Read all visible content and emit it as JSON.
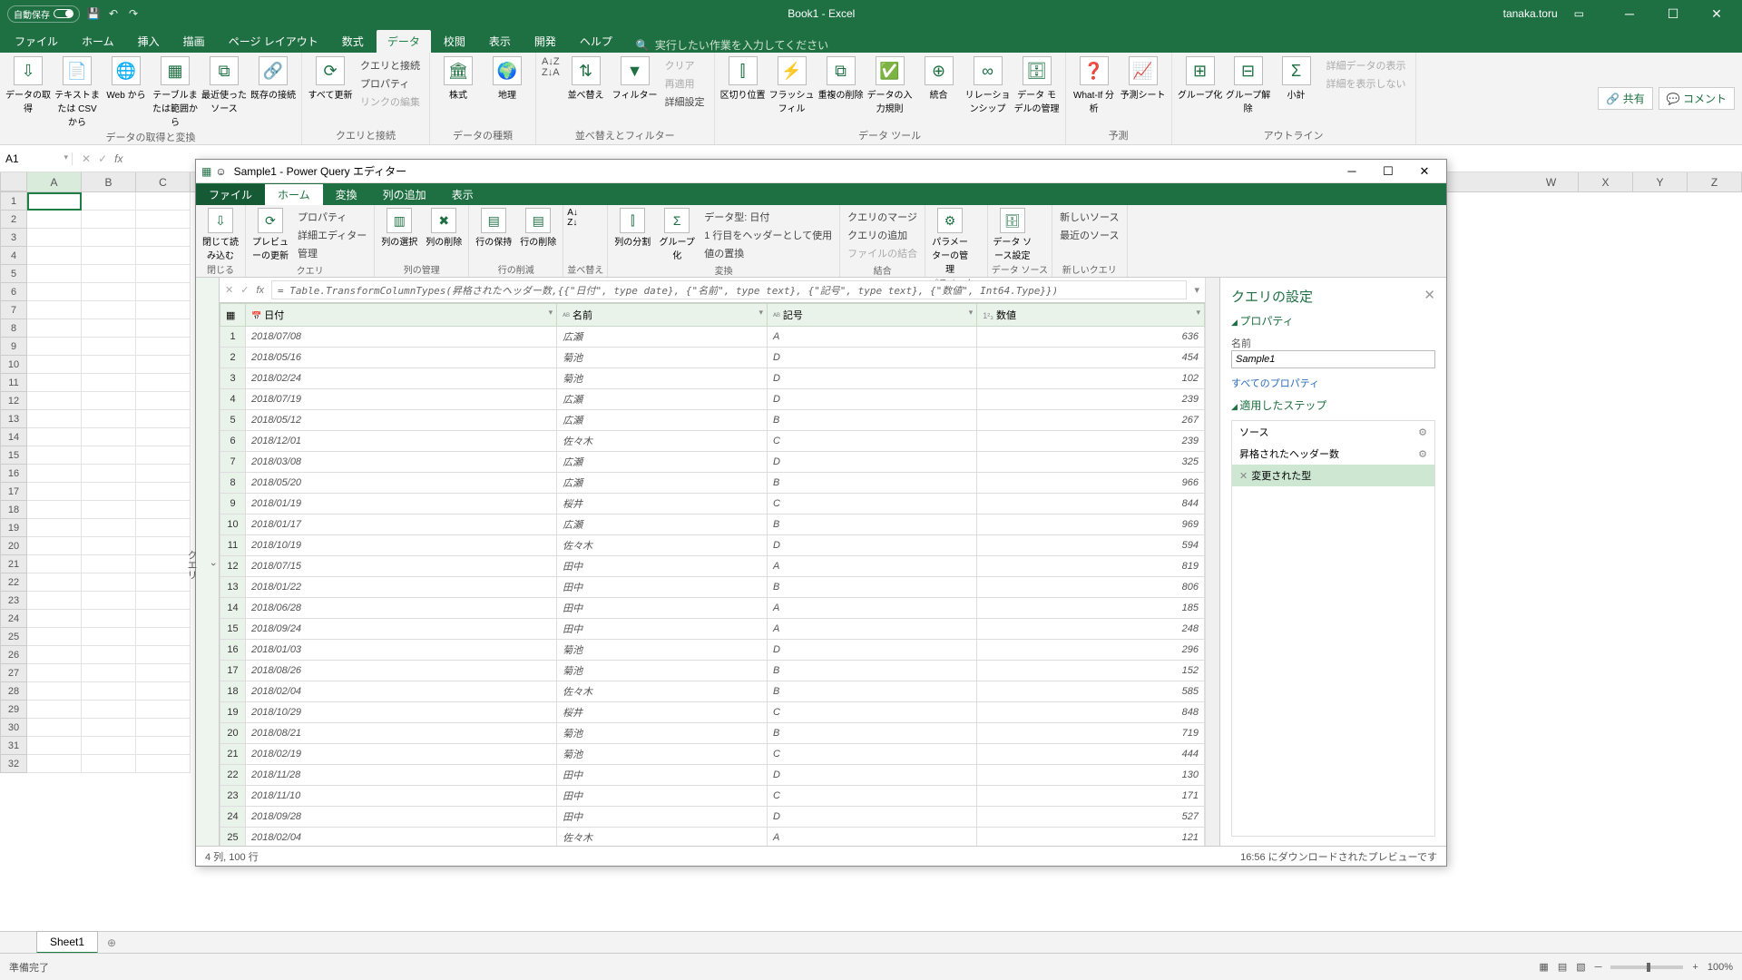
{
  "titlebar": {
    "autosave": "自動保存",
    "title": "Book1 - Excel",
    "user": "tanaka.toru"
  },
  "main_tabs": [
    "ファイル",
    "ホーム",
    "挿入",
    "描画",
    "ページ レイアウト",
    "数式",
    "データ",
    "校閲",
    "表示",
    "開発",
    "ヘルプ"
  ],
  "main_tab_active": 6,
  "search_placeholder": "実行したい作業を入力してください",
  "share": "共有",
  "comment": "コメント",
  "ribbon_groups": {
    "g1": {
      "label": "データの取得と変換",
      "btns": [
        "データの取得",
        "テキストまたは CSV から",
        "Web から",
        "テーブルまたは範囲から",
        "最近使ったソース",
        "既存の接続"
      ]
    },
    "g2": {
      "label": "クエリと接続",
      "refresh": "すべて更新",
      "items": [
        "クエリと接続",
        "プロパティ",
        "リンクの編集"
      ]
    },
    "g3": {
      "label": "データの種類",
      "btns": [
        "株式",
        "地理"
      ]
    },
    "g4": {
      "label": "並べ替えとフィルター",
      "az": "並べ替え",
      "flt": "フィルター",
      "items": [
        "クリア",
        "再適用",
        "詳細設定"
      ]
    },
    "g5": {
      "label": "データ ツール",
      "btns": [
        "区切り位置",
        "フラッシュフィル",
        "重複の削除",
        "データの入力規則",
        "統合",
        "リレーションシップ",
        "データ モデルの管理"
      ]
    },
    "g6": {
      "label": "予測",
      "btns": [
        "What-If 分析",
        "予測シート"
      ]
    },
    "g7": {
      "label": "アウトライン",
      "btns": [
        "グループ化",
        "グループ解除",
        "小計"
      ],
      "items": [
        "詳細データの表示",
        "詳細を表示しない"
      ]
    }
  },
  "name_box": "A1",
  "excel_cols": [
    "",
    "A",
    "B",
    "C",
    "W",
    "X",
    "Y",
    "Z"
  ],
  "sheet_tab": "Sheet1",
  "status_left": "準備完了",
  "zoom": "100%",
  "pq": {
    "title": "Sample1 - Power Query エディター",
    "tabs": [
      "ファイル",
      "ホーム",
      "変換",
      "列の追加",
      "表示"
    ],
    "tab_active": 1,
    "ribbon": {
      "close": {
        "label": "閉じる",
        "btn": "閉じて読み込む"
      },
      "query": {
        "label": "クエリ",
        "btn": "プレビューの更新",
        "items": [
          "プロパティ",
          "詳細エディター",
          "管理"
        ]
      },
      "colmgmt": {
        "label": "列の管理",
        "btns": [
          "列の選択",
          "列の削除"
        ]
      },
      "rowred": {
        "label": "行の削減",
        "btns": [
          "行の保持",
          "行の削除"
        ]
      },
      "sort": {
        "label": "並べ替え"
      },
      "transform": {
        "label": "変換",
        "btns": [
          "列の分割",
          "グループ化"
        ],
        "items": [
          "データ型: 日付",
          "1 行目をヘッダーとして使用",
          "値の置換"
        ]
      },
      "combine": {
        "label": "結合",
        "items": [
          "クエリのマージ",
          "クエリの追加",
          "ファイルの結合"
        ]
      },
      "param": {
        "label": "パラメーター",
        "btn": "パラメーターの管理"
      },
      "ds": {
        "label": "データ ソース",
        "btn": "データ ソース設定"
      },
      "newq": {
        "label": "新しいクエリ",
        "items": [
          "新しいソース",
          "最近のソース"
        ]
      }
    },
    "fx": "= Table.TransformColumnTypes(昇格されたヘッダー数,{{\"日付\", type date}, {\"名前\", type text}, {\"記号\", type text}, {\"数値\", Int64.Type}})",
    "columns": [
      "日付",
      "名前",
      "記号",
      "数値"
    ],
    "rows": [
      [
        "2018/07/08",
        "広瀬",
        "A",
        "636"
      ],
      [
        "2018/05/16",
        "菊池",
        "D",
        "454"
      ],
      [
        "2018/02/24",
        "菊池",
        "D",
        "102"
      ],
      [
        "2018/07/19",
        "広瀬",
        "D",
        "239"
      ],
      [
        "2018/05/12",
        "広瀬",
        "B",
        "267"
      ],
      [
        "2018/12/01",
        "佐々木",
        "C",
        "239"
      ],
      [
        "2018/03/08",
        "広瀬",
        "D",
        "325"
      ],
      [
        "2018/05/20",
        "広瀬",
        "B",
        "966"
      ],
      [
        "2018/01/19",
        "桜井",
        "C",
        "844"
      ],
      [
        "2018/01/17",
        "広瀬",
        "B",
        "969"
      ],
      [
        "2018/10/19",
        "佐々木",
        "D",
        "594"
      ],
      [
        "2018/07/15",
        "田中",
        "A",
        "819"
      ],
      [
        "2018/01/22",
        "田中",
        "B",
        "806"
      ],
      [
        "2018/06/28",
        "田中",
        "A",
        "185"
      ],
      [
        "2018/09/24",
        "田中",
        "A",
        "248"
      ],
      [
        "2018/01/03",
        "菊池",
        "D",
        "296"
      ],
      [
        "2018/08/26",
        "菊池",
        "B",
        "152"
      ],
      [
        "2018/02/04",
        "佐々木",
        "B",
        "585"
      ],
      [
        "2018/10/29",
        "桜井",
        "C",
        "848"
      ],
      [
        "2018/08/21",
        "菊池",
        "B",
        "719"
      ],
      [
        "2018/02/19",
        "菊池",
        "C",
        "444"
      ],
      [
        "2018/11/28",
        "田中",
        "D",
        "130"
      ],
      [
        "2018/11/10",
        "田中",
        "C",
        "171"
      ],
      [
        "2018/09/28",
        "田中",
        "D",
        "527"
      ],
      [
        "2018/02/04",
        "佐々木",
        "A",
        "121"
      ]
    ],
    "settings": {
      "title": "クエリの設定",
      "prop": "プロパティ",
      "name_label": "名前",
      "name_value": "Sample1",
      "all_props": "すべてのプロパティ",
      "applied": "適用したステップ",
      "steps": [
        "ソース",
        "昇格されたヘッダー数",
        "変更された型"
      ],
      "step_active": 2
    },
    "status_left": "4 列, 100 行",
    "status_right": "16:56 にダウンロードされたプレビューです"
  }
}
